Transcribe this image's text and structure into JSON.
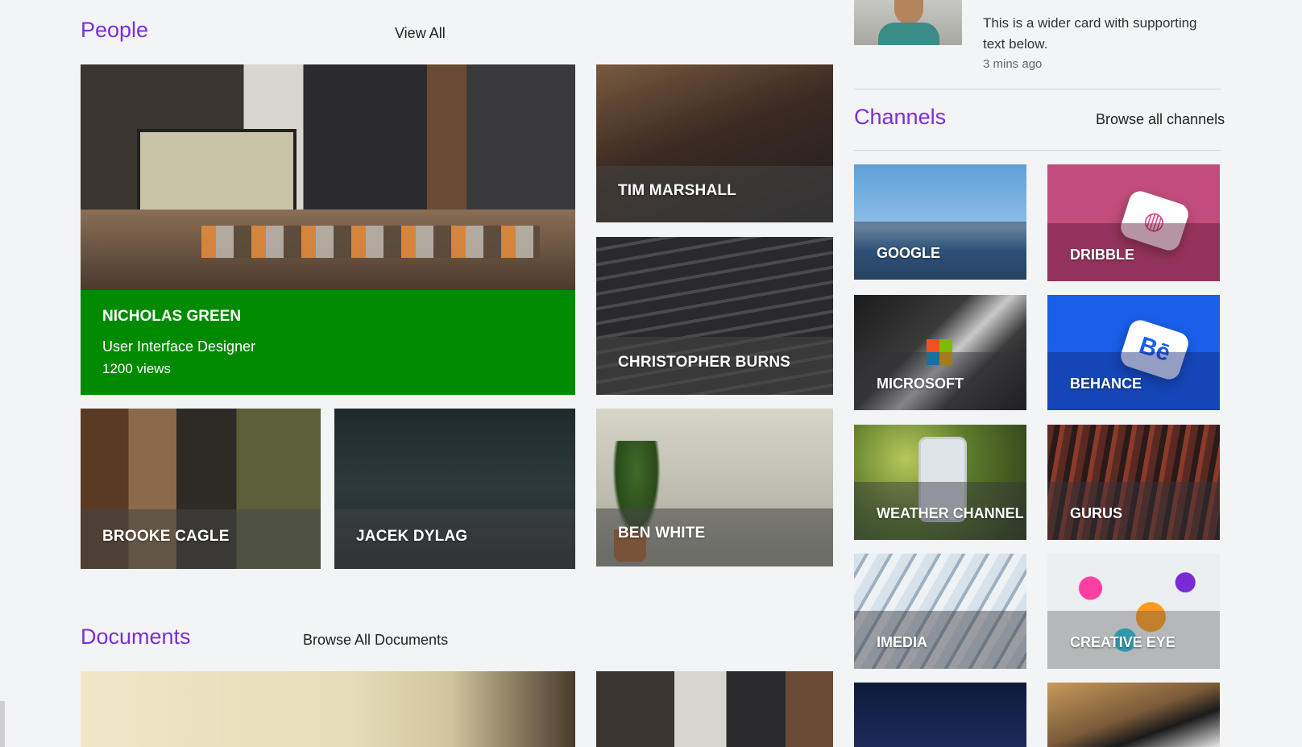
{
  "feed_card": {
    "text": "This is a wider card with supporting text below.",
    "time": "3 mins ago"
  },
  "people": {
    "title": "People",
    "view_all": "View All",
    "featured": {
      "name": "NICHOLAS GREEN",
      "role": "User Interface Designer",
      "views": "1200 views",
      "accent_color": "#008a00"
    },
    "tiles": [
      "TIM MARSHALL",
      "CHRISTOPHER BURNS",
      "BROOKE CAGLE",
      "JACEK DYLAG",
      "BEN WHITE"
    ]
  },
  "channels": {
    "title": "Channels",
    "browse_all": "Browse all channels",
    "items": [
      "GOOGLE",
      "DRIBBLE",
      "MICROSOFT",
      "BEHANCE",
      "WEATHER CHANNEL",
      "GURUS",
      "IMEDIA",
      "CREATIVE EYE"
    ]
  },
  "documents": {
    "title": "Documents",
    "browse_all": "Browse All Documents"
  },
  "colors": {
    "accent": "#7b2fd6",
    "background": "#f3f4f6"
  }
}
